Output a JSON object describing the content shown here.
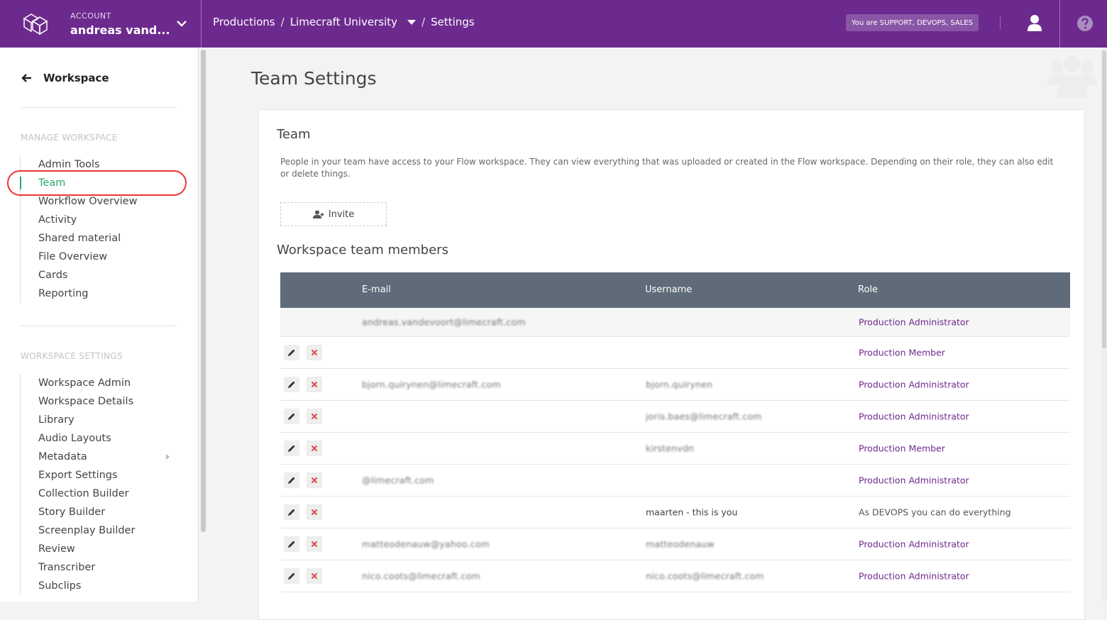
{
  "topbar": {
    "account_label": "ACCOUNT",
    "account_name": "andreas vand...",
    "breadcrumbs": [
      "Productions",
      "Limecraft University",
      "Settings"
    ],
    "role_badge": "You are SUPPORT, DEVOPS, SALES",
    "icons": [
      "logo-icon",
      "chevron-down-icon",
      "user-icon",
      "help-icon"
    ]
  },
  "sidebar": {
    "back_label": "Workspace",
    "manage_heading": "MANAGE WORKSPACE",
    "manage_items": [
      {
        "label": "Admin Tools"
      },
      {
        "label": "Team"
      },
      {
        "label": "Workflow Overview"
      },
      {
        "label": "Activity"
      },
      {
        "label": "Shared material"
      },
      {
        "label": "File Overview"
      },
      {
        "label": "Cards"
      },
      {
        "label": "Reporting"
      }
    ],
    "active_item": "Team",
    "settings_heading": "WORKSPACE SETTINGS",
    "settings_items": [
      {
        "label": "Workspace Admin"
      },
      {
        "label": "Workspace Details"
      },
      {
        "label": "Library"
      },
      {
        "label": "Audio Layouts"
      },
      {
        "label": "Metadata"
      },
      {
        "label": "Export Settings"
      },
      {
        "label": "Collection Builder"
      },
      {
        "label": "Story Builder"
      },
      {
        "label": "Screenplay Builder"
      },
      {
        "label": "Review"
      },
      {
        "label": "Transcriber"
      },
      {
        "label": "Subclips"
      }
    ]
  },
  "main": {
    "page_title": "Team Settings",
    "card_title": "Team",
    "description": "People in your team have access to your Flow workspace. They can view everything that was uploaded or created in the Flow workspace. Depending on their role, they can also edit or delete things.",
    "invite_label": "Invite",
    "members_title": "Workspace team members",
    "columns": {
      "email": "E-mail",
      "username": "Username",
      "role": "Role"
    },
    "rows": [
      {
        "email": "andreas.vandevoort@limecraft.com",
        "username": "",
        "role": "Production Administrator",
        "actions": false
      },
      {
        "email": "",
        "username": "",
        "role": "Production Member",
        "actions": true
      },
      {
        "email": "bjorn.quirynen@limecraft.com",
        "username": "bjorn.quirynen",
        "role": "Production Administrator",
        "actions": true
      },
      {
        "email": "",
        "username": "joris.baes@limecraft.com",
        "role": "Production Administrator",
        "actions": true
      },
      {
        "email": "",
        "username": "kirstenvdn",
        "role": "Production Member",
        "actions": true
      },
      {
        "email": "@limecraft.com",
        "username": "",
        "role": "Production Administrator",
        "actions": true
      },
      {
        "email": "",
        "username": "maarten",
        "you_suffix": " - this is you",
        "role": "As DEVOPS you can do everything",
        "actions": true,
        "is_you": true
      },
      {
        "email": "matteodenauw@yahoo.com",
        "username": "matteodenauw",
        "role": "Production Administrator",
        "actions": true
      },
      {
        "email": "nico.coots@limecraft.com",
        "username": "nico.coots@limecraft.com",
        "role": "Production Administrator",
        "actions": true
      }
    ]
  },
  "colors": {
    "brand": "#6d2a8e",
    "active": "#2aa76b",
    "table_header": "#5f6b78",
    "delete": "#d9534f"
  }
}
